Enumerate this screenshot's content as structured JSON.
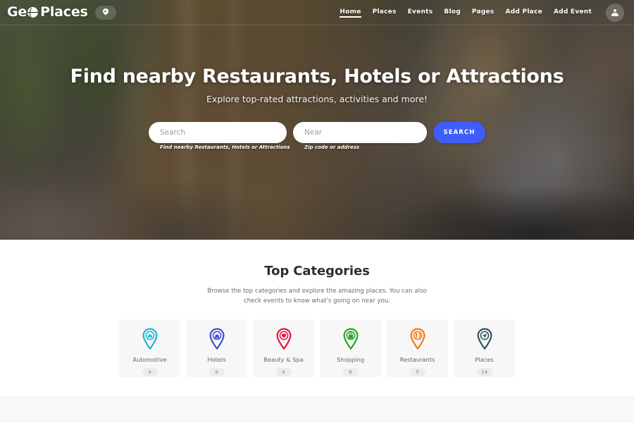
{
  "header": {
    "brand_pre": "Ge",
    "brand_post": "Places",
    "brand_globe_icon": "globe-icon",
    "location_pin_icon": "map-pin-icon",
    "avatar_icon": "user-avatar-icon",
    "nav": [
      {
        "label": "Home",
        "name": "nav-item-home",
        "active": true
      },
      {
        "label": "Places",
        "name": "nav-item-places",
        "active": false
      },
      {
        "label": "Events",
        "name": "nav-item-events",
        "active": false
      },
      {
        "label": "Blog",
        "name": "nav-item-blog",
        "active": false
      },
      {
        "label": "Pages",
        "name": "nav-item-pages",
        "active": false
      },
      {
        "label": "Add Place",
        "name": "nav-item-add-place",
        "active": false
      },
      {
        "label": "Add Event",
        "name": "nav-item-add-event",
        "active": false
      }
    ]
  },
  "hero": {
    "title": "Find nearby Restaurants, Hotels or Attractions",
    "subtitle": "Explore top-rated attractions, activities and more!",
    "search": {
      "keyword_placeholder": "Search",
      "keyword_value": "",
      "keyword_hint": "Find nearby Restaurants, Hotels or Attractions",
      "near_placeholder": "Near",
      "near_value": "",
      "near_hint": "Zip code or address",
      "button_label": "SEARCH",
      "button_color": "#3e5dfa"
    }
  },
  "categories": {
    "title": "Top Categories",
    "description": "Browse the top categories and explore the amazing places. You can also check events to know what's going on near you.",
    "items": [
      {
        "label": "Automotive",
        "count": "4",
        "color": "#19b5d2",
        "icon": "car-pin-icon"
      },
      {
        "label": "Hotels",
        "count": "4",
        "color": "#3d4ed0",
        "icon": "bed-pin-icon"
      },
      {
        "label": "Beauty & Spa",
        "count": "4",
        "color": "#e8123f",
        "icon": "spa-pin-icon"
      },
      {
        "label": "Shopping",
        "count": "8",
        "color": "#27a321",
        "icon": "shopping-bag-pin-icon"
      },
      {
        "label": "Restaurants",
        "count": "5",
        "color": "#f47812",
        "icon": "cutlery-pin-icon"
      },
      {
        "label": "Places",
        "count": "14",
        "color": "#2b5563",
        "icon": "navigation-pin-icon"
      }
    ]
  }
}
